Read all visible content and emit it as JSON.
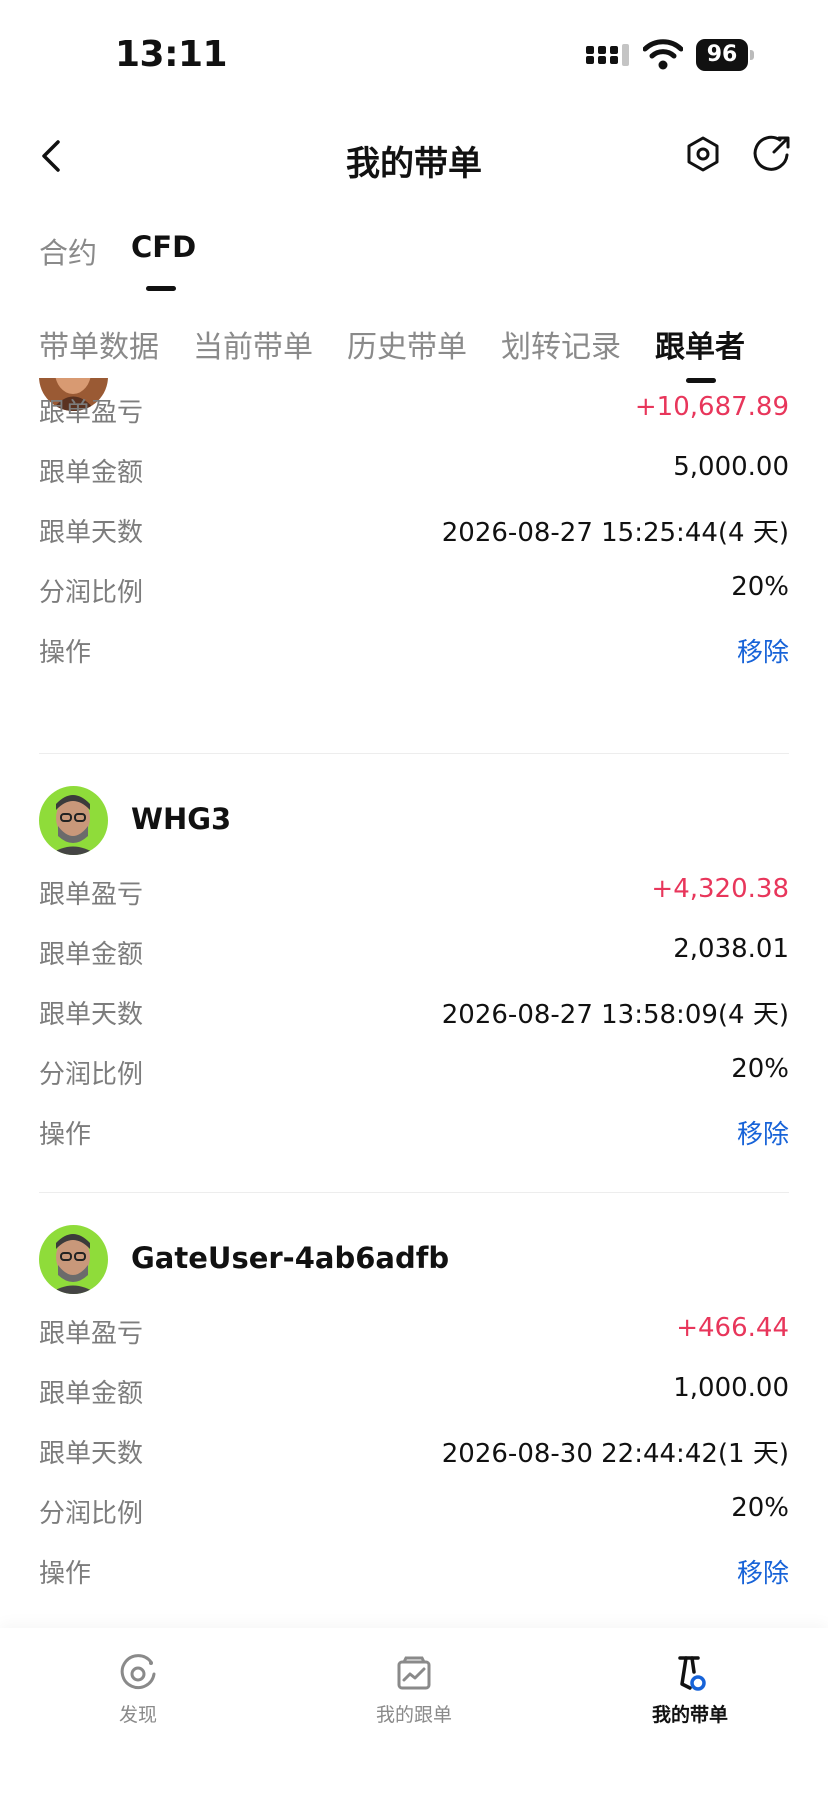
{
  "status_bar": {
    "time": "13:11",
    "battery": "96"
  },
  "header": {
    "title": "我的带单"
  },
  "top_tabs": [
    {
      "label": "合约",
      "active": false
    },
    {
      "label": "CFD",
      "active": true
    }
  ],
  "sub_tabs": [
    {
      "label": "带单数据",
      "active": false
    },
    {
      "label": "当前带单",
      "active": false
    },
    {
      "label": "历史带单",
      "active": false
    },
    {
      "label": "划转记录",
      "active": false
    },
    {
      "label": "跟单者",
      "active": true
    }
  ],
  "labels": {
    "profit": "跟单盈亏",
    "amount": "跟单金额",
    "days": "跟单天数",
    "share": "分润比例",
    "action": "操作"
  },
  "followers": [
    {
      "name": "",
      "profit": "+10,687.89",
      "amount": "5,000.00",
      "days": "2026-08-27 15:25:44(4 天)",
      "share_ratio": "20%",
      "action": "移除"
    },
    {
      "name": "WHG3",
      "profit": "+4,320.38",
      "amount": "2,038.01",
      "days": "2026-08-27 13:58:09(4 天)",
      "share_ratio": "20%",
      "action": "移除"
    },
    {
      "name": "GateUser-4ab6adfb",
      "profit": "+466.44",
      "amount": "1,000.00",
      "days": "2026-08-30 22:44:42(1 天)",
      "share_ratio": "20%",
      "action": "移除"
    }
  ],
  "bottom_nav": [
    {
      "label": "发现",
      "icon": "discover-icon",
      "active": false
    },
    {
      "label": "我的跟单",
      "icon": "chart-board-icon",
      "active": false
    },
    {
      "label": "我的带单",
      "icon": "trader-flag-icon",
      "active": true
    }
  ],
  "colors": {
    "profit": "#e8365b",
    "link": "#1763d8",
    "avatar_green": "#8fdc3a"
  }
}
